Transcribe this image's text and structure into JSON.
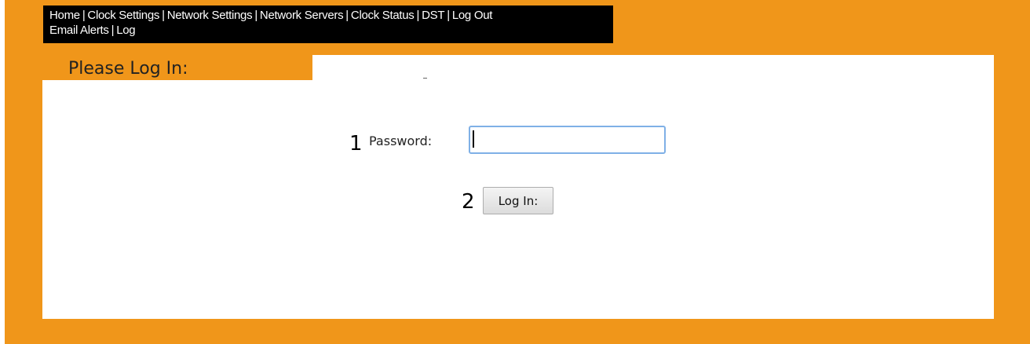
{
  "nav": {
    "links": [
      {
        "label": "Home"
      },
      {
        "label": "Clock Settings"
      },
      {
        "label": "Network Settings"
      },
      {
        "label": "Network Servers"
      },
      {
        "label": "Clock Status"
      },
      {
        "label": "DST"
      },
      {
        "label": "Log Out"
      },
      {
        "label": "Email Alerts"
      },
      {
        "label": "Log"
      }
    ],
    "separator": "|"
  },
  "page": {
    "title": "Please Log In:"
  },
  "form": {
    "marker_1": "1",
    "password_label": "Password:",
    "password_value": "",
    "marker_2": "2",
    "login_label": "Log In:"
  },
  "colors": {
    "frame": "#f0961a",
    "navbar": "#000000",
    "panel": "#ffffff",
    "input_border": "#7fb0e6"
  }
}
